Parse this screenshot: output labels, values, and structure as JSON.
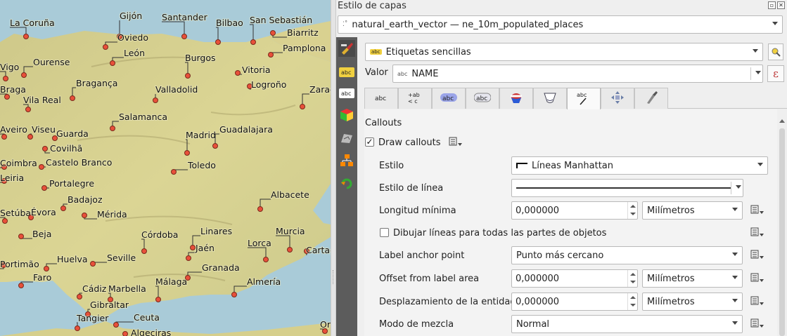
{
  "map": {
    "cities": [
      {
        "name": "La Coruña",
        "dot": [
          37,
          52
        ],
        "lbl": [
          14,
          37
        ]
      },
      {
        "name": "Gijón",
        "dot": [
          170,
          52
        ],
        "lbl": [
          170,
          27
        ]
      },
      {
        "name": "Santander",
        "dot": [
          262,
          52
        ],
        "lbl": [
          230,
          29
        ]
      },
      {
        "name": "Bilbao",
        "dot": [
          310,
          60
        ],
        "lbl": [
          307,
          37
        ]
      },
      {
        "name": "San Sebastián",
        "dot": [
          360,
          60
        ],
        "lbl": [
          355,
          33
        ]
      },
      {
        "name": "Oviedo",
        "dot": [
          150,
          67
        ],
        "lbl": [
          167,
          58
        ]
      },
      {
        "name": "Biarritz",
        "dot": [
          388,
          47
        ],
        "lbl": [
          408,
          51
        ]
      },
      {
        "name": "Pamplona",
        "dot": [
          385,
          78
        ],
        "lbl": [
          402,
          73
        ]
      },
      {
        "name": "León",
        "dot": [
          160,
          90
        ],
        "lbl": [
          176,
          80
        ]
      },
      {
        "name": "Ourense",
        "dot": [
          34,
          107
        ],
        "lbl": [
          47,
          93
        ]
      },
      {
        "name": "Vigo",
        "dot": [
          8,
          112
        ],
        "lbl": [
          0,
          100
        ]
      },
      {
        "name": "Burgos",
        "dot": [
          267,
          108
        ],
        "lbl": [
          263,
          87
        ]
      },
      {
        "name": "Vitoria",
        "dot": [
          338,
          104
        ],
        "lbl": [
          344,
          104
        ]
      },
      {
        "name": "Braga",
        "dot": [
          10,
          138
        ],
        "lbl": [
          0,
          132
        ]
      },
      {
        "name": "Bragança",
        "dot": [
          103,
          140
        ],
        "lbl": [
          108,
          123
        ]
      },
      {
        "name": "Valladolid",
        "dot": [
          221,
          143
        ],
        "lbl": [
          221,
          132
        ]
      },
      {
        "name": "Logroño",
        "dot": [
          355,
          123
        ],
        "lbl": [
          357,
          125
        ]
      },
      {
        "name": "Zaragoza",
        "dot": [
          430,
          152
        ],
        "lbl": [
          440,
          132
        ]
      },
      {
        "name": "Vila Real",
        "dot": [
          40,
          156
        ],
        "lbl": [
          33,
          147
        ]
      },
      {
        "name": "Salamanca",
        "dot": [
          160,
          183
        ],
        "lbl": [
          169,
          171
        ]
      },
      {
        "name": "Aveiro",
        "dot": [
          6,
          195
        ],
        "lbl": [
          0,
          189
        ]
      },
      {
        "name": "Viseu",
        "dot": [
          43,
          195
        ],
        "lbl": [
          45,
          189
        ]
      },
      {
        "name": "Guarda",
        "dot": [
          78,
          197
        ],
        "lbl": [
          80,
          195
        ]
      },
      {
        "name": "Madrid",
        "dot": [
          266,
          218
        ],
        "lbl": [
          264,
          197
        ]
      },
      {
        "name": "Guadalajara",
        "dot": [
          306,
          208
        ],
        "lbl": [
          312,
          189
        ]
      },
      {
        "name": "Covilhã",
        "dot": [
          64,
          212
        ],
        "lbl": [
          71,
          216
        ]
      },
      {
        "name": "Castelo Branco",
        "dot": [
          59,
          238
        ],
        "lbl": [
          65,
          236
        ]
      },
      {
        "name": "Toledo",
        "dot": [
          247,
          245
        ],
        "lbl": [
          267,
          240
        ]
      },
      {
        "name": "Coimbra",
        "dot": [
          6,
          238
        ],
        "lbl": [
          0,
          237
        ]
      },
      {
        "name": "Leiria",
        "dot": [
          6,
          258
        ],
        "lbl": [
          0,
          258
        ]
      },
      {
        "name": "Portalegre",
        "dot": [
          63,
          268
        ],
        "lbl": [
          70,
          266
        ]
      },
      {
        "name": "Albacete",
        "dot": [
          370,
          298
        ],
        "lbl": [
          385,
          282
        ]
      },
      {
        "name": "Badajoz",
        "dot": [
          90,
          297
        ],
        "lbl": [
          96,
          289
        ]
      },
      {
        "name": "Mérida",
        "dot": [
          120,
          307
        ],
        "lbl": [
          138,
          310
        ]
      },
      {
        "name": "Setúbal",
        "dot": [
          7,
          315
        ],
        "lbl": [
          0,
          308
        ]
      },
      {
        "name": "Évora",
        "dot": [
          44,
          310
        ],
        "lbl": [
          44,
          307
        ]
      },
      {
        "name": "Córdoba",
        "dot": [
          205,
          358
        ],
        "lbl": [
          201,
          339
        ]
      },
      {
        "name": "Linares",
        "dot": [
          274,
          353
        ],
        "lbl": [
          285,
          334
        ]
      },
      {
        "name": "Murcia",
        "dot": [
          412,
          356
        ],
        "lbl": [
          392,
          334
        ]
      },
      {
        "name": "Beja",
        "dot": [
          30,
          337
        ],
        "lbl": [
          46,
          338
        ]
      },
      {
        "name": "Lorca",
        "dot": [
          378,
          370
        ],
        "lbl": [
          352,
          351
        ]
      },
      {
        "name": "Jaén",
        "dot": [
          268,
          368
        ],
        "lbl": [
          278,
          358
        ]
      },
      {
        "name": "Cartagena",
        "dot": [
          436,
          358
        ],
        "lbl": [
          435,
          361
        ]
      },
      {
        "name": "Huelva",
        "dot": [
          66,
          383
        ],
        "lbl": [
          81,
          374
        ]
      },
      {
        "name": "Seville",
        "dot": [
          132,
          376
        ],
        "lbl": [
          152,
          372
        ]
      },
      {
        "name": "Portimão",
        "dot": [
          5,
          378
        ],
        "lbl": [
          0,
          381
        ]
      },
      {
        "name": "Granada",
        "dot": [
          267,
          396
        ],
        "lbl": [
          287,
          386
        ]
      },
      {
        "name": "Faro",
        "dot": [
          30,
          407
        ],
        "lbl": [
          47,
          400
        ]
      },
      {
        "name": "Almería",
        "dot": [
          333,
          420
        ],
        "lbl": [
          351,
          406
        ]
      },
      {
        "name": "Cádiz",
        "dot": [
          113,
          423
        ],
        "lbl": [
          117,
          416
        ]
      },
      {
        "name": "Marbella",
        "dot": [
          157,
          427
        ],
        "lbl": [
          154,
          416
        ]
      },
      {
        "name": "Málaga",
        "dot": [
          225,
          427
        ],
        "lbl": [
          221,
          406
        ]
      },
      {
        "name": "Gibraltar",
        "dot": [
          125,
          448
        ],
        "lbl": [
          128,
          439
        ]
      },
      {
        "name": "Tangier",
        "dot": [
          110,
          468
        ],
        "lbl": [
          109,
          458
        ]
      },
      {
        "name": "Ceuta",
        "dot": [
          165,
          463
        ],
        "lbl": [
          190,
          457
        ]
      },
      {
        "name": "Algeciras",
        "dot": [
          178,
          476
        ],
        "lbl": [
          186,
          479
        ]
      },
      {
        "name": "Oran",
        "dot": [
          462,
          472
        ],
        "lbl": [
          455,
          467
        ]
      }
    ]
  },
  "panel": {
    "title": "Estilo de capas",
    "layer_selector": "natural_earth_vector — ne_10m_populated_places",
    "label_mode": "Etiquetas sencillas",
    "value_label": "Valor",
    "value_field": "NAME",
    "value_field_prefix": "abc",
    "section": "Callouts",
    "draw_callouts_label": "Draw callouts",
    "rows": {
      "estilo_label": "Estilo",
      "estilo_value": "Líneas Manhattan",
      "estilo_linea_label": "Estilo de línea",
      "longitud_label": "Longitud mínima",
      "longitud_value": "0,000000",
      "longitud_unit": "Milímetros",
      "dibujar_label": "Dibujar líneas para todas las partes de objetos",
      "anchor_label": "Label anchor point",
      "anchor_value": "Punto más cercano",
      "offset_label": "Offset from label area",
      "offset_value": "0,000000",
      "offset_unit": "Milímetros",
      "desplaz_label": "Desplazamiento de la entidad",
      "desplaz_value": "0,000000",
      "desplaz_unit": "Milímetros",
      "mezcla_label": "Modo de mezcla",
      "mezcla_value": "Normal"
    },
    "tab_icons": [
      "text-icon",
      "formatting-icon",
      "buffer-icon",
      "background-icon",
      "shadow-icon",
      "mask-icon",
      "callouts-icon",
      "placement-icon",
      "rendering-icon"
    ],
    "colors": {
      "map_land": "#d9d28e",
      "map_sea": "#a3c9da",
      "city_dot": "#e8503a",
      "toolbar": "#5c5c5c"
    }
  }
}
